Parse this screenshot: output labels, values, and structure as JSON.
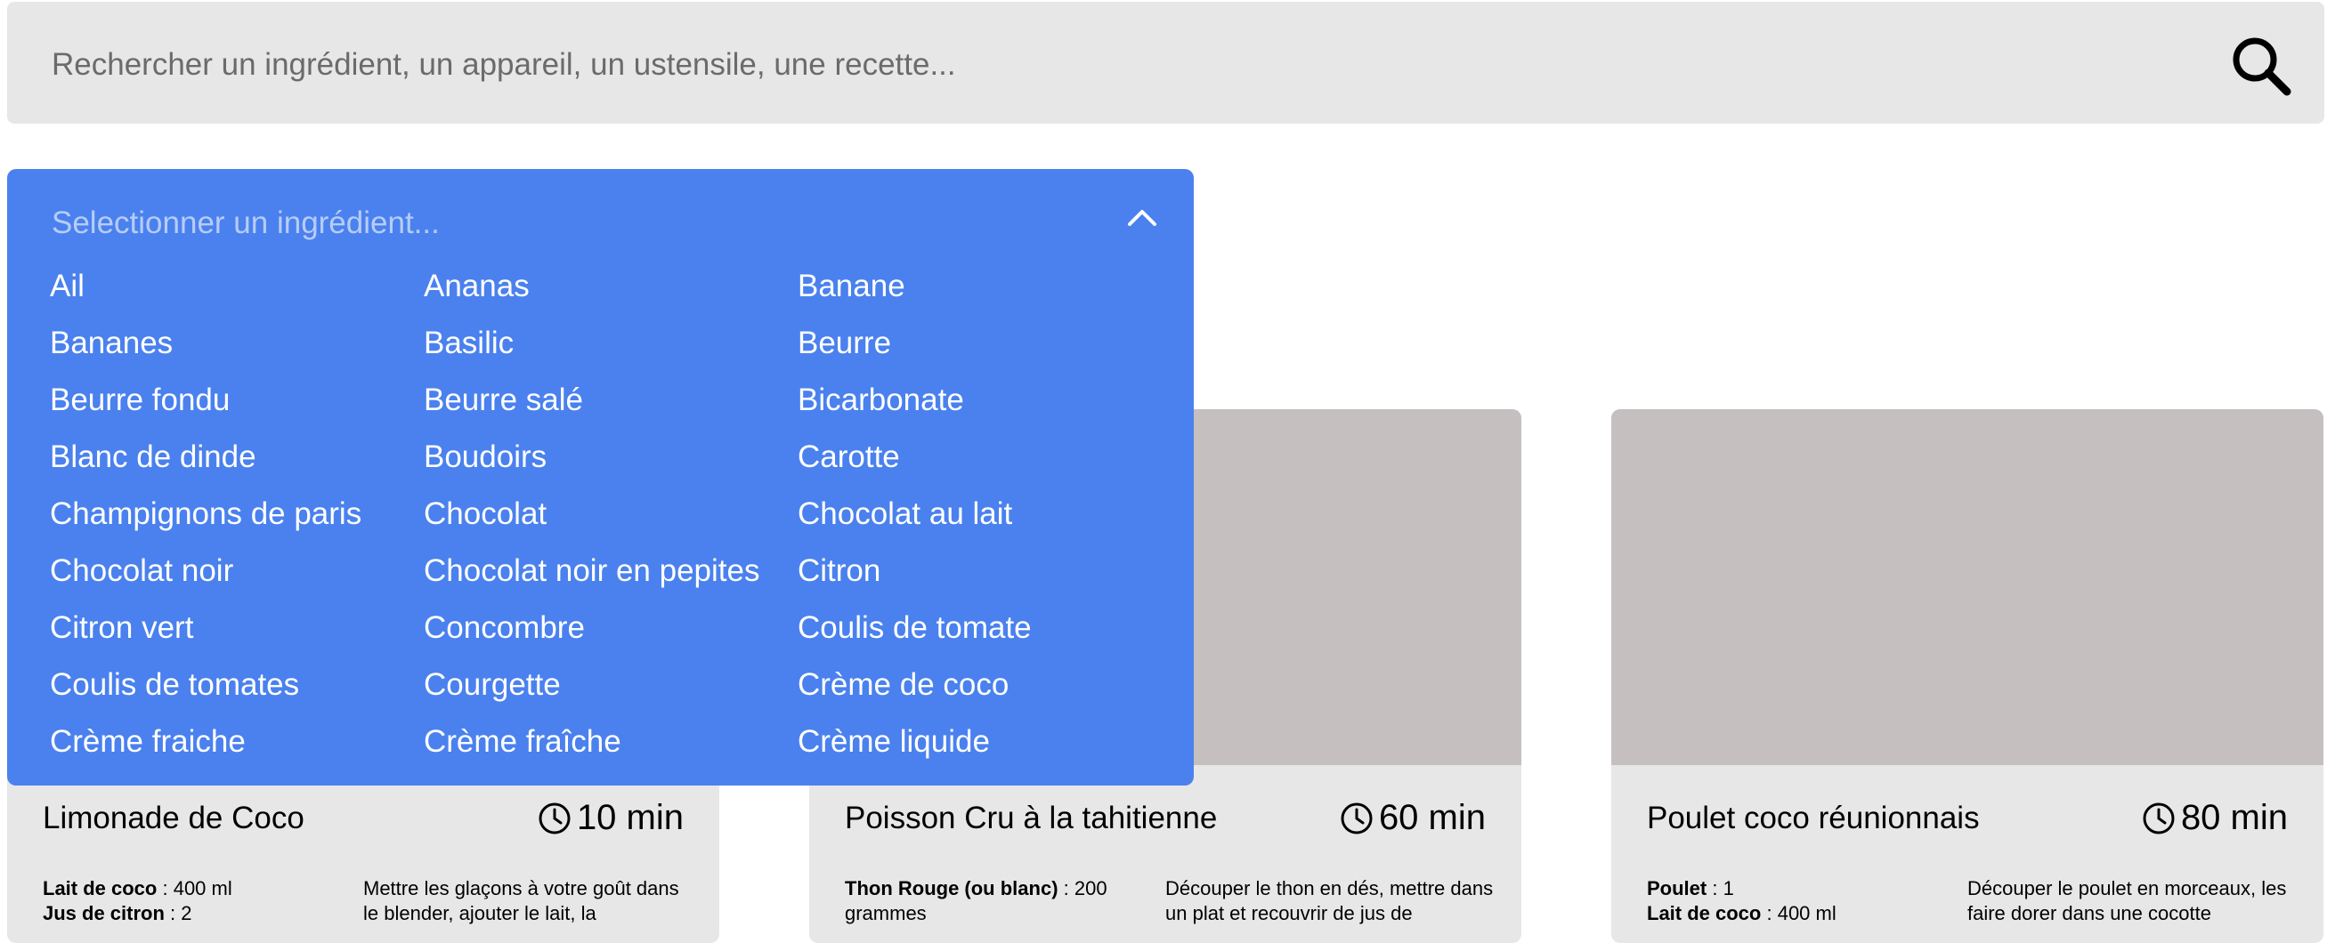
{
  "search": {
    "placeholder": "Rechercher un ingrédient, un appareil, un ustensile, une recette...",
    "icon": "search-icon"
  },
  "ingredient_dropdown": {
    "placeholder": "Selectionner un ingrédient...",
    "toggle_icon": "chevron-up-icon",
    "color": "#4a81ee",
    "items": [
      "Ail",
      "Ananas",
      "Banane",
      "Bananes",
      "Basilic",
      "Beurre",
      "Beurre fondu",
      "Beurre salé",
      "Bicarbonate",
      "Blanc de dinde",
      "Boudoirs",
      "Carotte",
      "Champignons de paris",
      "Chocolat",
      "Chocolat au lait",
      "Chocolat noir",
      "Chocolat noir en pepites",
      "Citron",
      "Citron vert",
      "Concombre",
      "Coulis de tomate",
      "Coulis de tomates",
      "Courgette",
      "Crème de coco",
      "Crème fraiche",
      "Crème fraîche",
      "Crème liquide"
    ]
  },
  "recipes": [
    {
      "title": "Limonade de Coco",
      "time": "10 min",
      "ingredients": [
        {
          "name": "Lait de coco",
          "qty": "400  ml"
        },
        {
          "name": "Jus de citron",
          "qty": "2"
        }
      ],
      "description": "Mettre les glaçons à votre goût dans le blender, ajouter le lait, la"
    },
    {
      "title": "Poisson Cru à la tahitienne",
      "time": "60 min",
      "ingredients": [
        {
          "name": "Thon Rouge (ou blanc)",
          "qty": "200 grammes"
        }
      ],
      "description": "Découper le thon en dés, mettre dans un plat et recouvrir de jus de"
    },
    {
      "title": "Poulet coco réunionnais",
      "time": "80 min",
      "ingredients": [
        {
          "name": "Poulet",
          "qty": "1"
        },
        {
          "name": "Lait de coco",
          "qty": "400  ml"
        }
      ],
      "description": "Découper le poulet en morceaux, les faire dorer dans une cocotte"
    }
  ],
  "colors": {
    "search_background": "#e7e7e7",
    "card_background": "#e7e7e7",
    "card_image_placeholder": "#c5bfbf"
  }
}
